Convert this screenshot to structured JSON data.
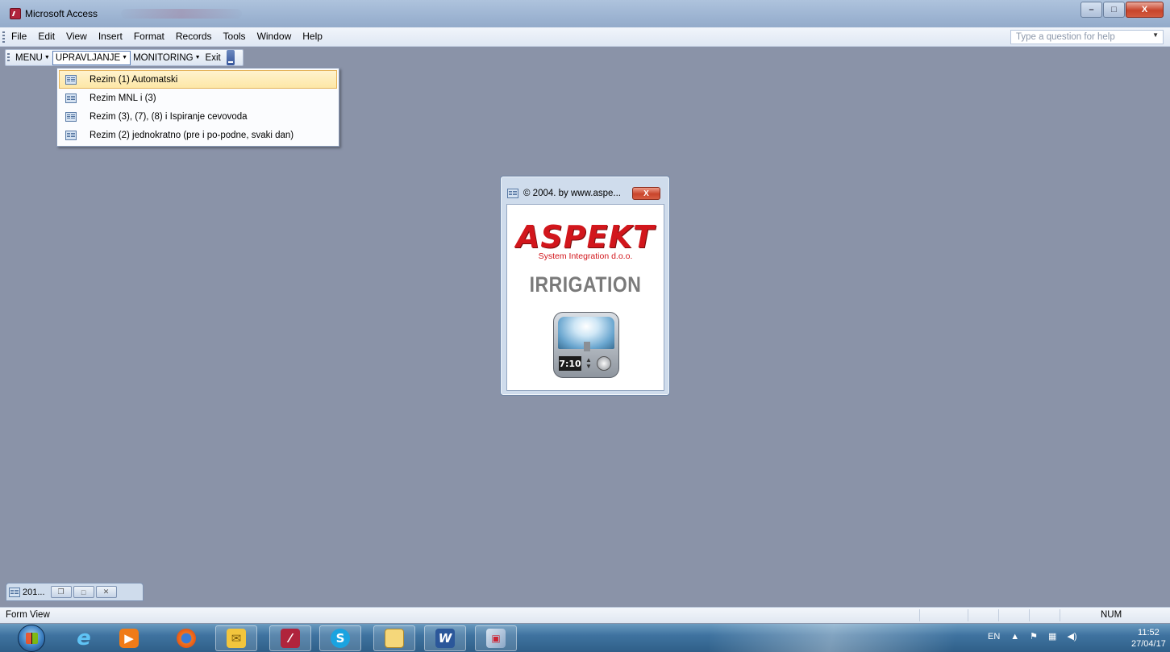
{
  "window": {
    "title": "Microsoft Access",
    "minimize": "–",
    "maximize": "□",
    "close": "X"
  },
  "menubar": {
    "items": [
      "File",
      "Edit",
      "View",
      "Insert",
      "Format",
      "Records",
      "Tools",
      "Window",
      "Help"
    ],
    "help_placeholder": "Type a question for help"
  },
  "toolbar": {
    "menu_label": "MENU",
    "upravljanje_label": "UPRAVLJANJE",
    "monitoring_label": "MONITORING",
    "exit_label": "Exit"
  },
  "dropdown": {
    "items": [
      "Rezim (1) Automatski",
      "Rezim MNL i (3)",
      "Rezim (3), (7), (8) i Ispiranje cevovoda",
      "Rezim (2) jednokratno (pre i po-podne, svaki dan)"
    ],
    "highlighted_index": 0
  },
  "splash": {
    "title": "© 2004. by www.aspe...",
    "close": "X",
    "logo_text": "ASPEKT",
    "logo_subtitle": "System Integration d.o.o.",
    "product_name": "IRRIGATION",
    "clock_text": "7:10"
  },
  "minimized_window": {
    "label": "201..."
  },
  "statusbar": {
    "text": "Form View",
    "num_indicator": "NUM"
  },
  "taskbar": {
    "apps": [
      "internet-explorer",
      "media-player",
      "firefox",
      "outlook",
      "access",
      "skype",
      "file-explorer",
      "word",
      "network-app"
    ],
    "language": "EN",
    "time": "11:52",
    "date": "27/04/17"
  },
  "colors": {
    "desktop_bg": "#8a93a8",
    "highlight": "#fde7a6",
    "logo_red": "#d2161c"
  }
}
